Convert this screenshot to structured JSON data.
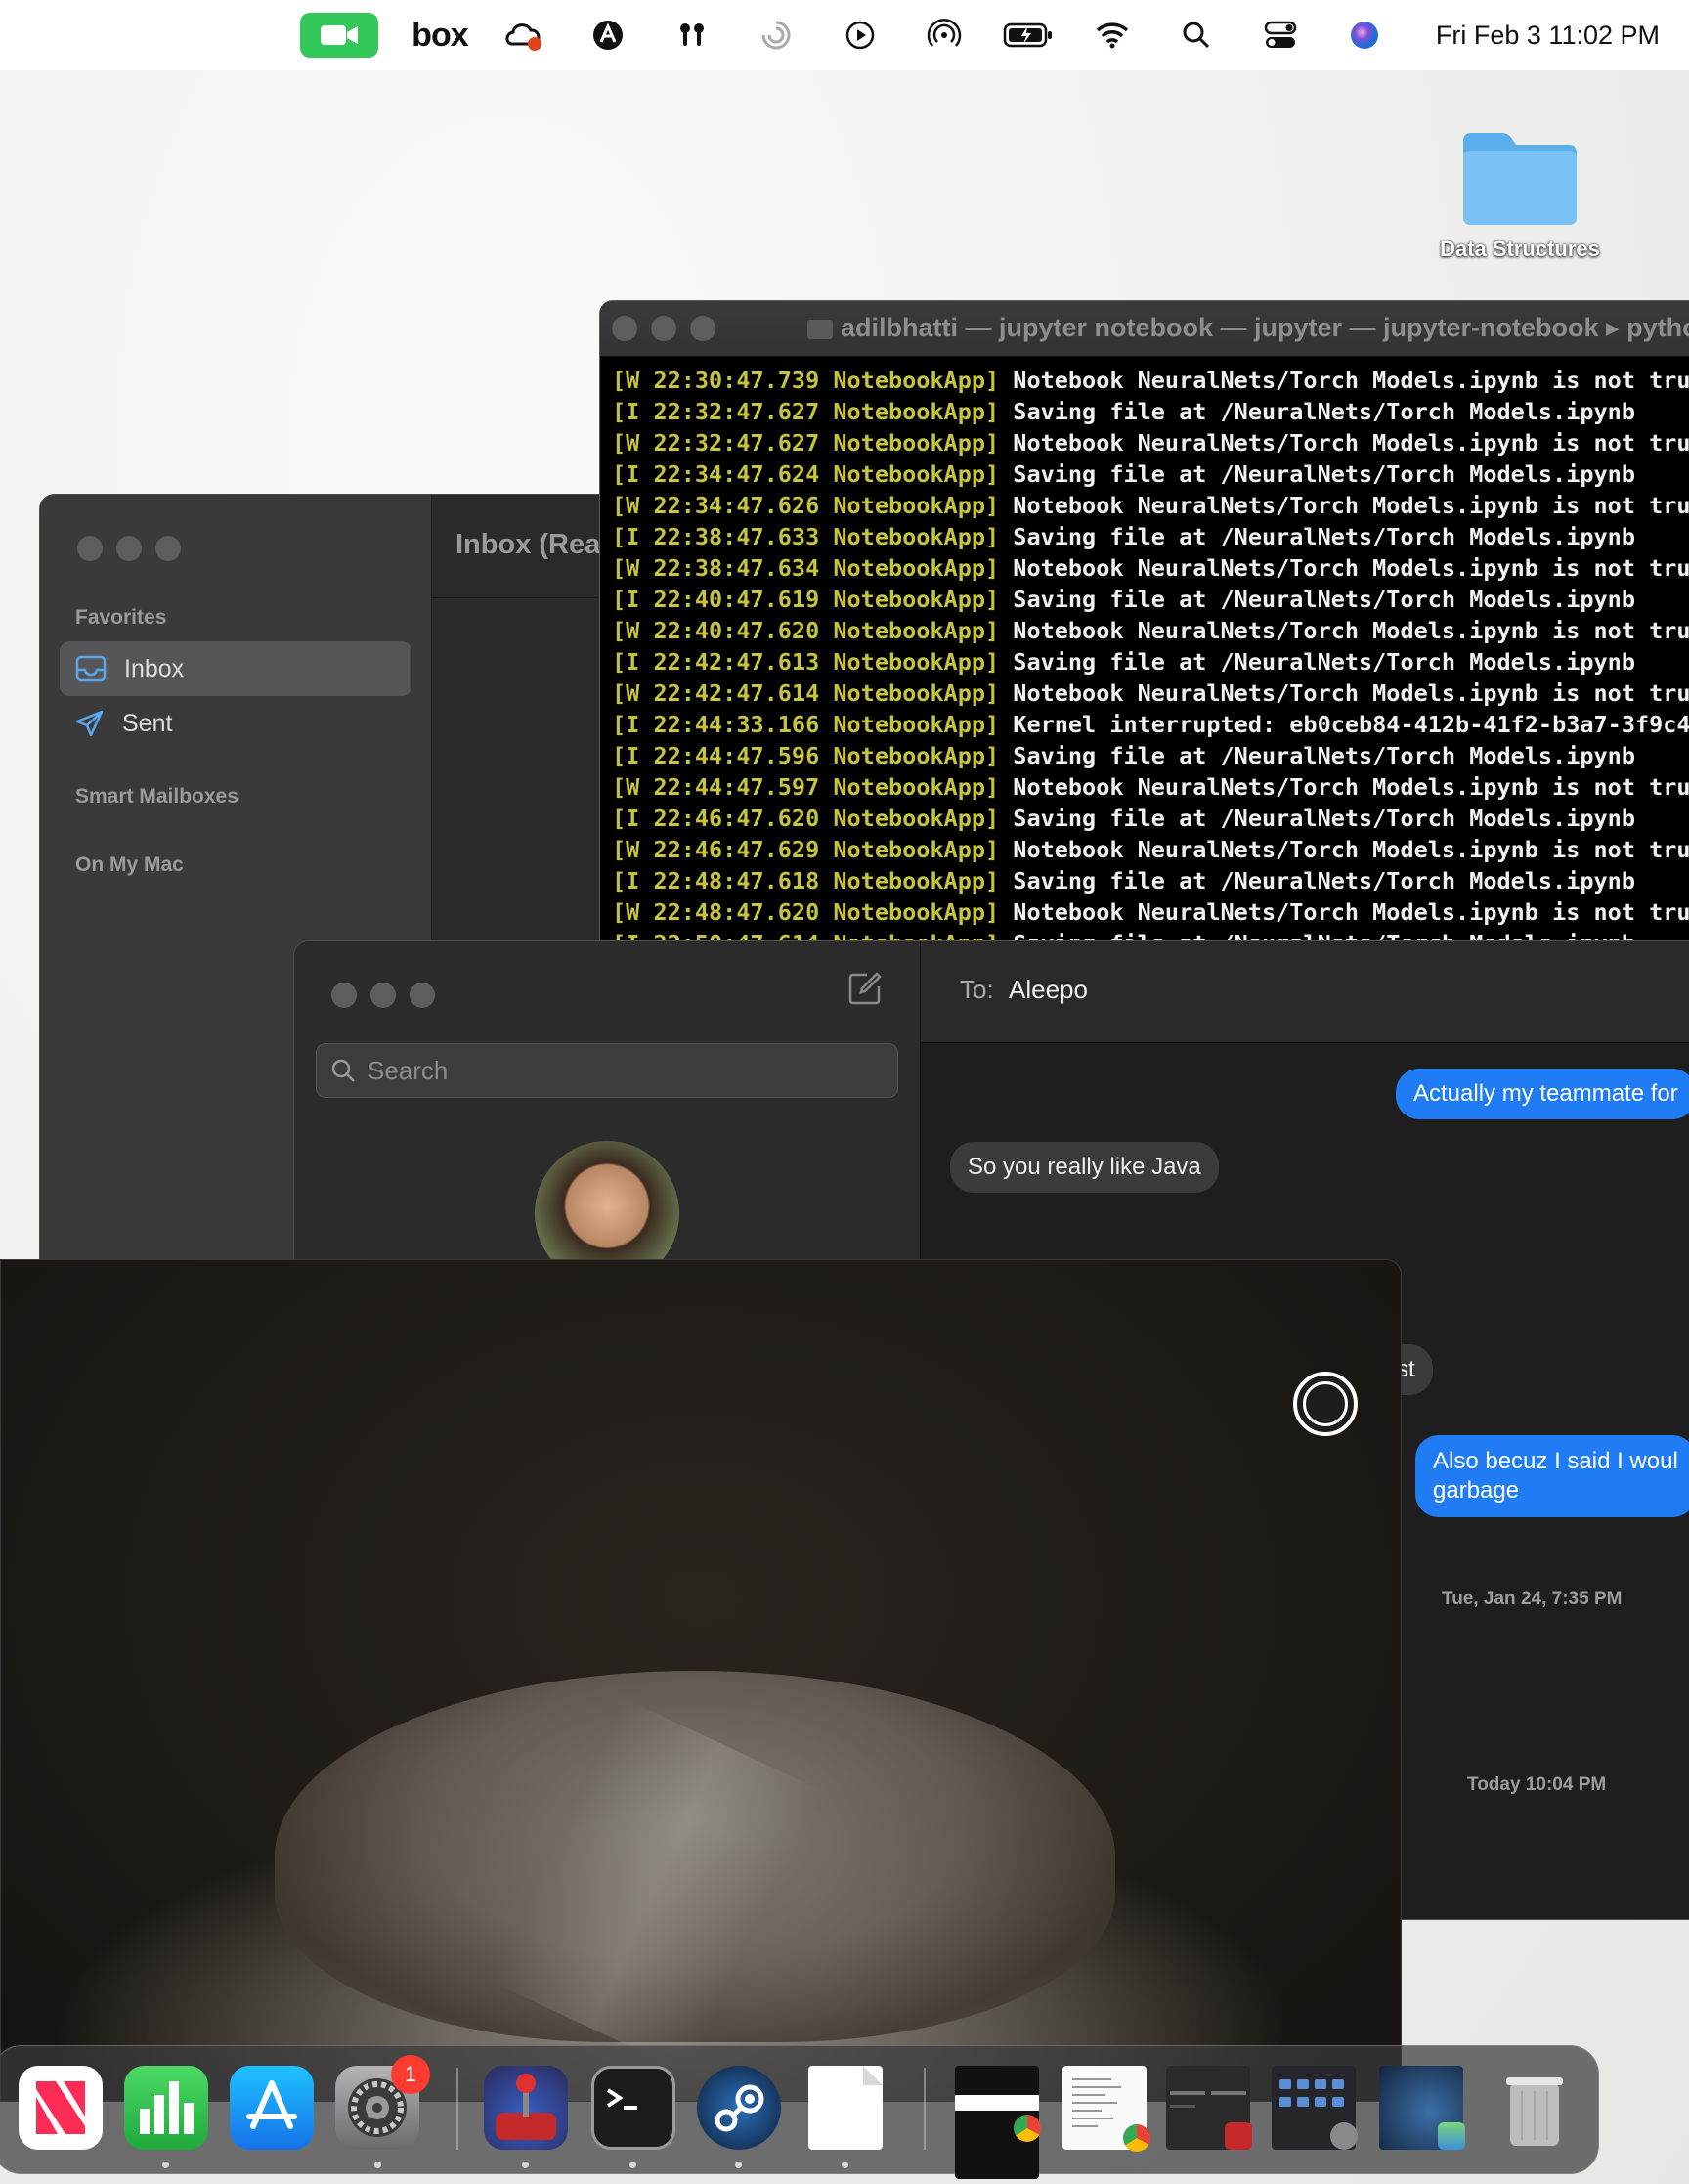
{
  "menubar": {
    "box_label": "box",
    "clock": "Fri Feb 3  11:02 PM",
    "icons": [
      "facetime-icon",
      "box-icon",
      "creative-cloud-icon",
      "vpn-icon",
      "airpods-icon",
      "focus-icon",
      "play-icon",
      "airdrop-icon",
      "battery-icon",
      "wifi-icon",
      "search-icon",
      "control-center-icon",
      "siri-icon"
    ]
  },
  "desktop": {
    "folder_label": "Data Structures"
  },
  "mail": {
    "title": "Inbox (Rea",
    "favorites_label": "Favorites",
    "inbox_label": "Inbox",
    "sent_label": "Sent",
    "smart_mailboxes_label": "Smart Mailboxes",
    "on_my_mac_label": "On My Mac"
  },
  "terminal": {
    "title": "adilbhatti — jupyter notebook — jupyter — jupyter-notebook ▸ pytho",
    "lines": [
      {
        "tag": "[W 22:30:47.739 NotebookApp]",
        "msg": " Notebook NeuralNets/Torch Models.ipynb is not trus"
      },
      {
        "tag": "[I 22:32:47.627 NotebookApp]",
        "msg": " Saving file at /NeuralNets/Torch Models.ipynb"
      },
      {
        "tag": "[W 22:32:47.627 NotebookApp]",
        "msg": " Notebook NeuralNets/Torch Models.ipynb is not trus"
      },
      {
        "tag": "[I 22:34:47.624 NotebookApp]",
        "msg": " Saving file at /NeuralNets/Torch Models.ipynb"
      },
      {
        "tag": "[W 22:34:47.626 NotebookApp]",
        "msg": " Notebook NeuralNets/Torch Models.ipynb is not trus"
      },
      {
        "tag": "[I 22:38:47.633 NotebookApp]",
        "msg": " Saving file at /NeuralNets/Torch Models.ipynb"
      },
      {
        "tag": "[W 22:38:47.634 NotebookApp]",
        "msg": " Notebook NeuralNets/Torch Models.ipynb is not trus"
      },
      {
        "tag": "[I 22:40:47.619 NotebookApp]",
        "msg": " Saving file at /NeuralNets/Torch Models.ipynb"
      },
      {
        "tag": "[W 22:40:47.620 NotebookApp]",
        "msg": " Notebook NeuralNets/Torch Models.ipynb is not trus"
      },
      {
        "tag": "[I 22:42:47.613 NotebookApp]",
        "msg": " Saving file at /NeuralNets/Torch Models.ipynb"
      },
      {
        "tag": "[W 22:42:47.614 NotebookApp]",
        "msg": " Notebook NeuralNets/Torch Models.ipynb is not trus"
      },
      {
        "tag": "[I 22:44:33.166 NotebookApp]",
        "msg": " Kernel interrupted: eb0ceb84-412b-41f2-b3a7-3f9c4a"
      },
      {
        "tag": "[I 22:44:47.596 NotebookApp]",
        "msg": " Saving file at /NeuralNets/Torch Models.ipynb"
      },
      {
        "tag": "[W 22:44:47.597 NotebookApp]",
        "msg": " Notebook NeuralNets/Torch Models.ipynb is not trus"
      },
      {
        "tag": "[I 22:46:47.620 NotebookApp]",
        "msg": " Saving file at /NeuralNets/Torch Models.ipynb"
      },
      {
        "tag": "[W 22:46:47.629 NotebookApp]",
        "msg": " Notebook NeuralNets/Torch Models.ipynb is not trus"
      },
      {
        "tag": "[I 22:48:47.618 NotebookApp]",
        "msg": " Saving file at /NeuralNets/Torch Models.ipynb"
      },
      {
        "tag": "[W 22:48:47.620 NotebookApp]",
        "msg": " Notebook NeuralNets/Torch Models.ipynb is not trus"
      },
      {
        "tag": "[I 22:50:47.614 NotebookApp]",
        "msg": " Saving file at /NeuralNets/Torch Models.ipynb"
      }
    ]
  },
  "messages": {
    "search_placeholder": "Search",
    "to_label": "To:",
    "to_name": "Aleepo",
    "bubble_out_1": "Actually my teammate for",
    "bubble_in_1": "So you really like Java",
    "bubble_in_2": "test",
    "bubble_out_2_line1": "Also becuz I said I woul",
    "bubble_out_2_line2": "garbage",
    "timestamp_1": "Tue, Jan 24, 7:35 PM",
    "timestamp_2": "Today 10:04 PM"
  },
  "dock": {
    "settings_badge": "1",
    "apps": [
      "news-icon",
      "numbers-icon",
      "app-store-icon",
      "system-settings-icon",
      "joystick-app-icon",
      "terminal-icon",
      "steam-icon",
      "document-icon",
      "chrome-window-thumbnail",
      "chrome-doc-thumbnail",
      "app-window-thumbnail",
      "settings-window-thumbnail",
      "maps-window-thumbnail",
      "trash-icon"
    ]
  }
}
